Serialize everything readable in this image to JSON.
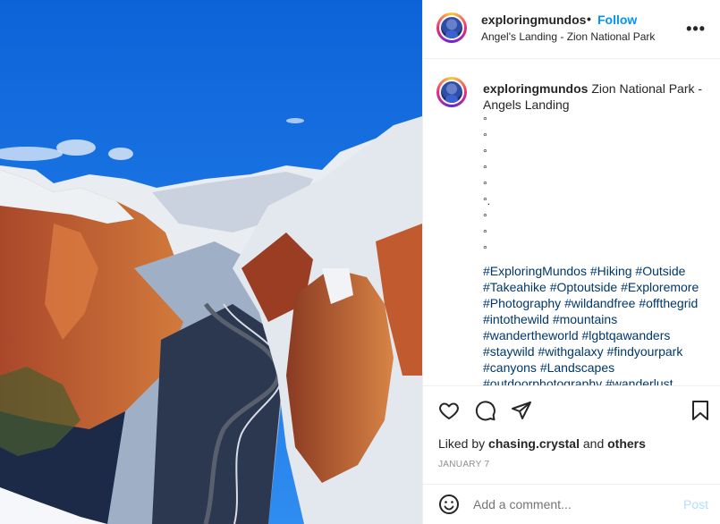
{
  "photo": {
    "description_icon": "mountain-canyon-photo",
    "colors": {
      "sky": "#1877e6",
      "rock": "#c2632f",
      "snow": "#f2f4f7"
    }
  },
  "header": {
    "username": "exploringmundos",
    "separator": "•",
    "follow_label": "Follow",
    "location": "Angel's Landing - Zion National Park",
    "more_icon": "more-horizontal-icon"
  },
  "caption": {
    "username": "exploringmundos",
    "text": "Zion National Park - Angels Landing",
    "bullets": [
      "°",
      "°",
      "°",
      "°",
      "°",
      "°.",
      "°",
      "°",
      "°"
    ],
    "hashtags": "#ExploringMundos #Hiking #Outside #Takeahike #Optoutside #Exploremore #Photography #wildandfree #offthegrid #intothewild #mountains #wandertheworld #lgbtqawanders #staywild #withgalaxy #findyourpark #canyons #Landscapes #outdoorphotography #wanderlust"
  },
  "actions": {
    "icons": [
      "heart-icon",
      "comment-icon",
      "share-icon",
      "bookmark-icon"
    ],
    "liked_by_prefix": "Liked by ",
    "liked_by_user": "chasing.crystal",
    "liked_by_suffix": " and ",
    "liked_by_others": "others",
    "date": "JANUARY 7"
  },
  "comment": {
    "placeholder": "Add a comment...",
    "post_label": "Post"
  },
  "colors": {
    "accent": "#0095f6",
    "link": "#00376b",
    "muted": "#8e8e8e",
    "post_disabled": "#b2dffc"
  }
}
